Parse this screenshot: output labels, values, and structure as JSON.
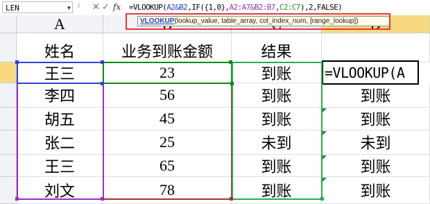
{
  "formula_bar": {
    "name_box": "LEN",
    "name_box_arrow": "▼",
    "separator": "⁞",
    "cancel_icon": "✕",
    "enter_icon": "✓",
    "fx_label": "fx",
    "formula_parts": [
      "=VLOOKUP(",
      "A2&B2",
      ",IF({1,0},",
      "A2:A7&B2:B7",
      ",",
      "C2:C7",
      "),2,FALSE)"
    ]
  },
  "tooltip": {
    "function_name": "VLOOKUP",
    "args": "(lookup_value, table_array, col_index_num, [range_lookup])"
  },
  "columns": [
    "A",
    "B",
    "C",
    "D"
  ],
  "active_column": "D",
  "rows": [
    {
      "a": "姓名",
      "b": "业务到账金额",
      "c": "结果",
      "d": ""
    },
    {
      "a": "王三",
      "b": "23",
      "c": "到账",
      "d": "=VLOOKUP(A"
    },
    {
      "a": "李四",
      "b": "56",
      "c": "到账",
      "d": "到账"
    },
    {
      "a": "胡五",
      "b": "45",
      "c": "到账",
      "d": "到账"
    },
    {
      "a": "张二",
      "b": "25",
      "c": "未到",
      "d": "未到"
    },
    {
      "a": "王三",
      "b": "65",
      "c": "到账",
      "d": "到账"
    },
    {
      "a": "刘文",
      "b": "78",
      "c": "到账",
      "d": "到账"
    }
  ],
  "colors": {
    "ref_a2b2": "#2b3fd6",
    "ref_a2a7": "#9a2cc4",
    "ref_b2b7": "#a0362a",
    "ref_c2c7": "#22b04a",
    "active_header": "#f9d980",
    "tooltip_outline": "#e8353a"
  }
}
